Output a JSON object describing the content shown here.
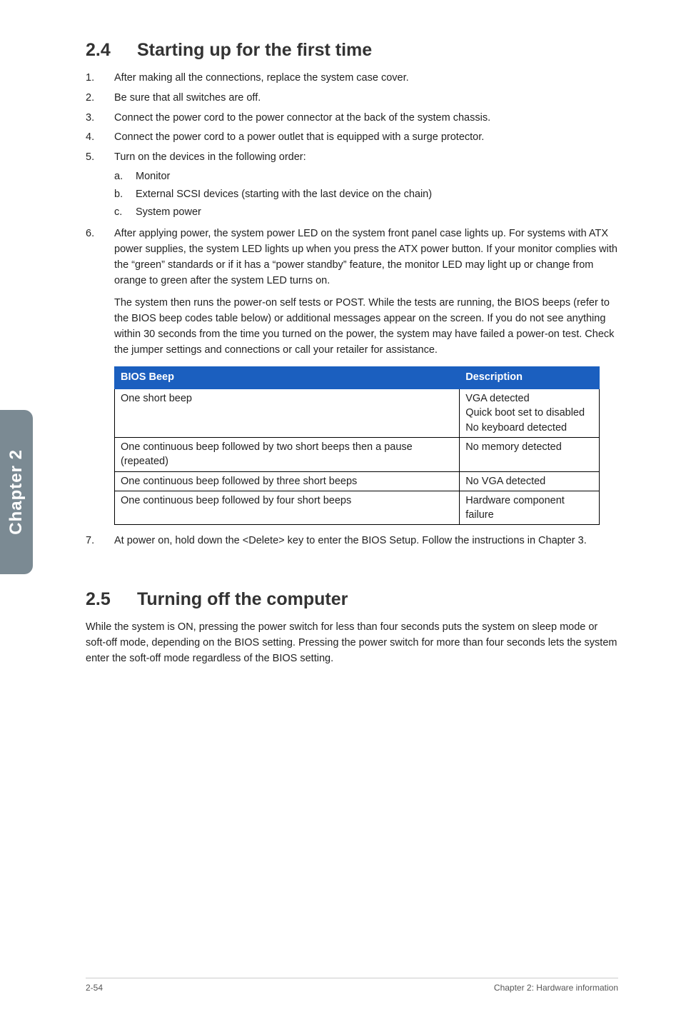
{
  "chapterTab": "Chapter 2",
  "section24": {
    "number": "2.4",
    "title": "Starting up for the first time",
    "steps": [
      {
        "n": "1.",
        "text": "After making all the connections, replace the system case cover."
      },
      {
        "n": "2.",
        "text": "Be sure that all switches are off."
      },
      {
        "n": "3.",
        "text": "Connect the power cord to the power connector at the back of the system chassis."
      },
      {
        "n": "4.",
        "text": "Connect the power cord to a power outlet that is equipped with a surge protector."
      },
      {
        "n": "5.",
        "text": "Turn on the devices in the following order:",
        "sub": [
          {
            "n": "a.",
            "text": "Monitor"
          },
          {
            "n": "b.",
            "text": "External SCSI devices (starting with the last device on the chain)"
          },
          {
            "n": "c.",
            "text": "System power"
          }
        ]
      },
      {
        "n": "6.",
        "text": "After applying power, the system power LED on the system front panel case lights up. For systems with ATX power supplies, the system LED lights up when you press the ATX power button. If your monitor complies with the “green” standards or if it has a “power standby” feature, the monitor LED may light up or change from orange to green after the system LED turns on.",
        "para2": "The system then runs the power-on self tests or POST. While the tests are running, the BIOS beeps (refer to the BIOS beep codes table below) or additional messages appear on the screen. If you do not see anything within 30 seconds from the time you turned on the power, the system may have failed a power-on test. Check the jumper settings and connections or call your retailer for assistance."
      },
      {
        "n": "7.",
        "text": "At power on, hold down the <Delete> key to enter the BIOS Setup. Follow the instructions in Chapter 3."
      }
    ],
    "table": {
      "headers": [
        "BIOS Beep",
        "Description"
      ],
      "rows": [
        [
          "One short beep",
          "VGA detected\nQuick boot set to disabled\nNo keyboard detected"
        ],
        [
          "One continuous beep followed by two short beeps then a pause (repeated)",
          "No memory detected"
        ],
        [
          "One continuous beep followed by three short beeps",
          "No VGA detected"
        ],
        [
          "One continuous beep followed by four short beeps",
          "Hardware component failure"
        ]
      ]
    }
  },
  "section25": {
    "number": "2.5",
    "title": "Turning off the computer",
    "body": "While the system is ON, pressing the power switch for less than four seconds puts the system on sleep mode or soft-off mode, depending on the BIOS setting. Pressing the power switch for more than four seconds lets the system enter the soft-off mode regardless of the BIOS setting."
  },
  "footer": {
    "left": "2-54",
    "right": "Chapter 2: Hardware information"
  }
}
